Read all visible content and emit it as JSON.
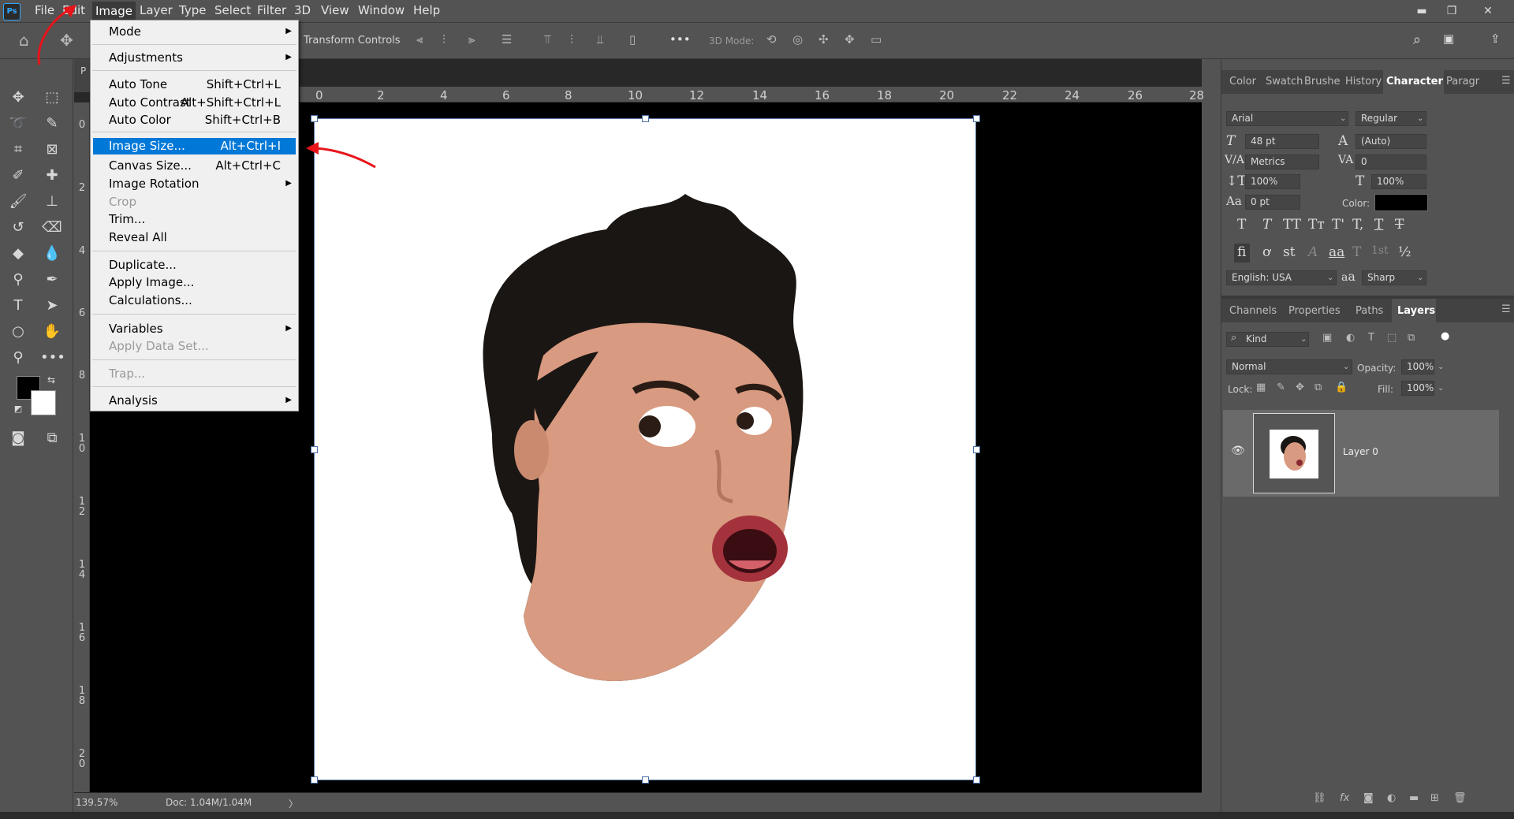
{
  "app": {
    "logo": "Ps"
  },
  "menubar": {
    "items": [
      "File",
      "Edit",
      "Image",
      "Layer",
      "Type",
      "Select",
      "Filter",
      "3D",
      "View",
      "Window",
      "Help"
    ],
    "active": "Image"
  },
  "window_controls": {
    "minimize": "▬",
    "restore": "❐",
    "close": "✕"
  },
  "options_bar": {
    "transform_controls": "Transform Controls",
    "mode3d": "3D Mode:",
    "more": "•••"
  },
  "doc_tab": {
    "label": "P"
  },
  "image_menu": {
    "items": [
      {
        "label": "Mode",
        "shortcut": "",
        "submenu": true,
        "disabled": false
      },
      {
        "label": "Adjustments",
        "shortcut": "",
        "submenu": true,
        "disabled": false
      },
      {
        "label": "Auto Tone",
        "shortcut": "Shift+Ctrl+L",
        "disabled": false
      },
      {
        "label": "Auto Contrast",
        "shortcut": "Alt+Shift+Ctrl+L",
        "disabled": false
      },
      {
        "label": "Auto Color",
        "shortcut": "Shift+Ctrl+B",
        "disabled": false
      },
      {
        "label": "Image Size...",
        "shortcut": "Alt+Ctrl+I",
        "disabled": false,
        "highlighted": true
      },
      {
        "label": "Canvas Size...",
        "shortcut": "Alt+Ctrl+C",
        "disabled": false
      },
      {
        "label": "Image Rotation",
        "shortcut": "",
        "submenu": true,
        "disabled": false
      },
      {
        "label": "Crop",
        "shortcut": "",
        "disabled": true
      },
      {
        "label": "Trim...",
        "shortcut": "",
        "disabled": false
      },
      {
        "label": "Reveal All",
        "shortcut": "",
        "disabled": false
      },
      {
        "label": "Duplicate...",
        "shortcut": "",
        "disabled": false
      },
      {
        "label": "Apply Image...",
        "shortcut": "",
        "disabled": false
      },
      {
        "label": "Calculations...",
        "shortcut": "",
        "disabled": false
      },
      {
        "label": "Variables",
        "shortcut": "",
        "submenu": true,
        "disabled": false
      },
      {
        "label": "Apply Data Set...",
        "shortcut": "",
        "disabled": true
      },
      {
        "label": "Trap...",
        "shortcut": "",
        "disabled": true
      },
      {
        "label": "Analysis",
        "shortcut": "",
        "submenu": true,
        "disabled": false
      }
    ]
  },
  "ruler": {
    "h": [
      "0",
      "2",
      "4",
      "6",
      "8",
      "10",
      "12",
      "14",
      "16",
      "18",
      "20",
      "22",
      "24",
      "26",
      "28"
    ],
    "v": [
      "0",
      "2",
      "4",
      "6",
      "8",
      "1\n0",
      "1\n2",
      "1\n4",
      "1\n6",
      "1\n8",
      "2\n0"
    ]
  },
  "status": {
    "zoom": "139.57%",
    "doc": "Doc: 1.04M/1.04M",
    "arrow": "〉"
  },
  "character_panel": {
    "tabs": [
      "Color",
      "Swatch",
      "Brushe",
      "History",
      "Character",
      "Paragr"
    ],
    "active_tab": "Character",
    "font_family": "Arial",
    "font_style": "Regular",
    "size": "48 pt",
    "leading": "(Auto)",
    "kerning": "Metrics",
    "tracking": "0",
    "vscale": "100%",
    "hscale": "100%",
    "baseline": "0 pt",
    "color_label": "Color:",
    "text_color": "#000000",
    "language": "English: USA",
    "aa_label": "a",
    "antialias": "Sharp",
    "style_glyphs": [
      "T",
      "T",
      "TT",
      "Tт",
      "T'",
      "T,",
      "T",
      "T"
    ],
    "opentype_glyphs": [
      "fi",
      "ơ",
      "st",
      "A",
      "aa",
      "T",
      "1st",
      "½"
    ]
  },
  "layers_panel": {
    "tabs": [
      "Channels",
      "Properties",
      "Paths",
      "Layers"
    ],
    "active_tab": "Layers",
    "filter": "Kind",
    "blend_mode": "Normal",
    "opacity_label": "Opacity:",
    "opacity": "100%",
    "lock_label": "Lock:",
    "fill_label": "Fill:",
    "fill": "100%",
    "layers": [
      {
        "name": "Layer 0",
        "visible": true
      }
    ]
  },
  "colors": {
    "foreground": "#000000",
    "background": "#ffffff",
    "highlight": "#0078d7",
    "annotation_arrow": "#e8141a"
  }
}
